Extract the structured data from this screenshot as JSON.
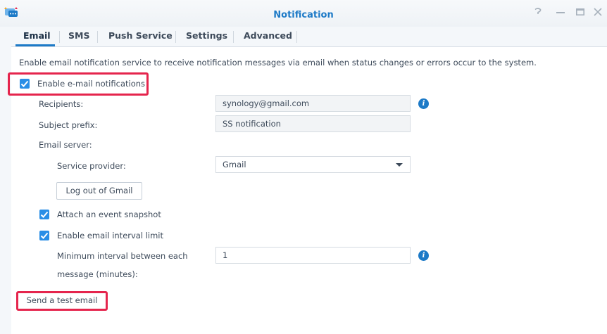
{
  "window": {
    "title": "Notification",
    "controls": [
      "help-icon",
      "minimize-icon",
      "maximize-icon",
      "close-icon"
    ],
    "accent_color": "#1d7ac7",
    "highlight_color": "#e5254d"
  },
  "tabs": [
    {
      "label": "Email",
      "active": true
    },
    {
      "label": "SMS",
      "active": false
    },
    {
      "label": "Push Service",
      "active": false
    },
    {
      "label": "Settings",
      "active": false
    },
    {
      "label": "Advanced",
      "active": false
    }
  ],
  "email": {
    "description": "Enable email notification service to receive notification messages via email when status changes or errors occur to the system.",
    "enable_label": "Enable e-mail notifications",
    "enable_checked": true,
    "recipients_label": "Recipients:",
    "recipients_value": "synology@gmail.com",
    "subject_label": "Subject prefix:",
    "subject_value": "SS notification",
    "server_label": "Email server:",
    "provider_label": "Service provider:",
    "provider_value": "Gmail",
    "logout_button": "Log out of Gmail",
    "snapshot_label": "Attach an event snapshot",
    "snapshot_checked": true,
    "interval_limit_label": "Enable email interval limit",
    "interval_limit_checked": true,
    "interval_label_line1": "Minimum interval between each",
    "interval_label_line2": "message (minutes):",
    "interval_value": "1",
    "test_button": "Send a test email"
  }
}
